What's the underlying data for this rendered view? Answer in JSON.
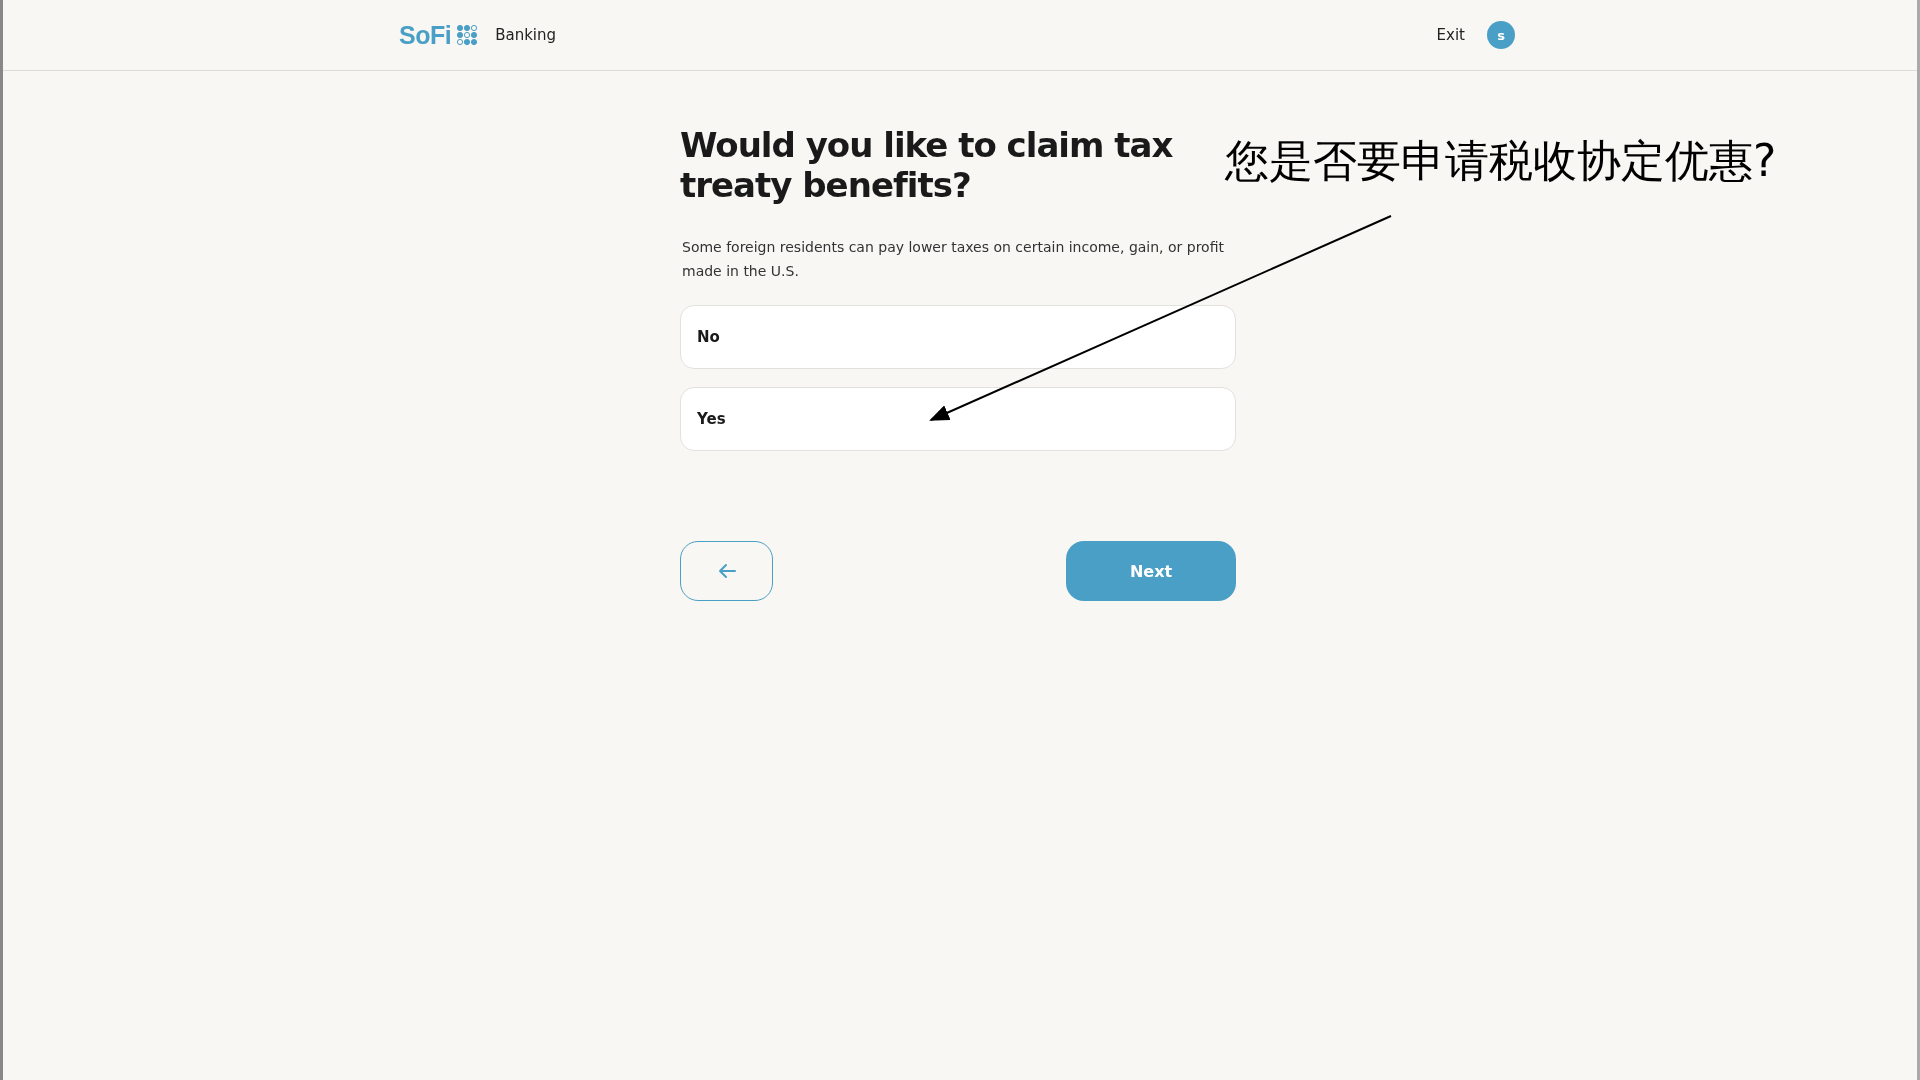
{
  "header": {
    "logo": "SoFi",
    "product": "Banking",
    "exit": "Exit",
    "avatar": "s"
  },
  "question": {
    "title": "Would you like to claim tax treaty benefits?",
    "description": "Some foreign residents can pay lower taxes on certain income, gain, or profit made in the U.S."
  },
  "options": [
    {
      "label": "No",
      "selected": false
    },
    {
      "label": "Yes",
      "selected": false
    }
  ],
  "buttons": {
    "next": "Next"
  },
  "annotation": {
    "text": "您是否要申请税收协定优惠?"
  }
}
